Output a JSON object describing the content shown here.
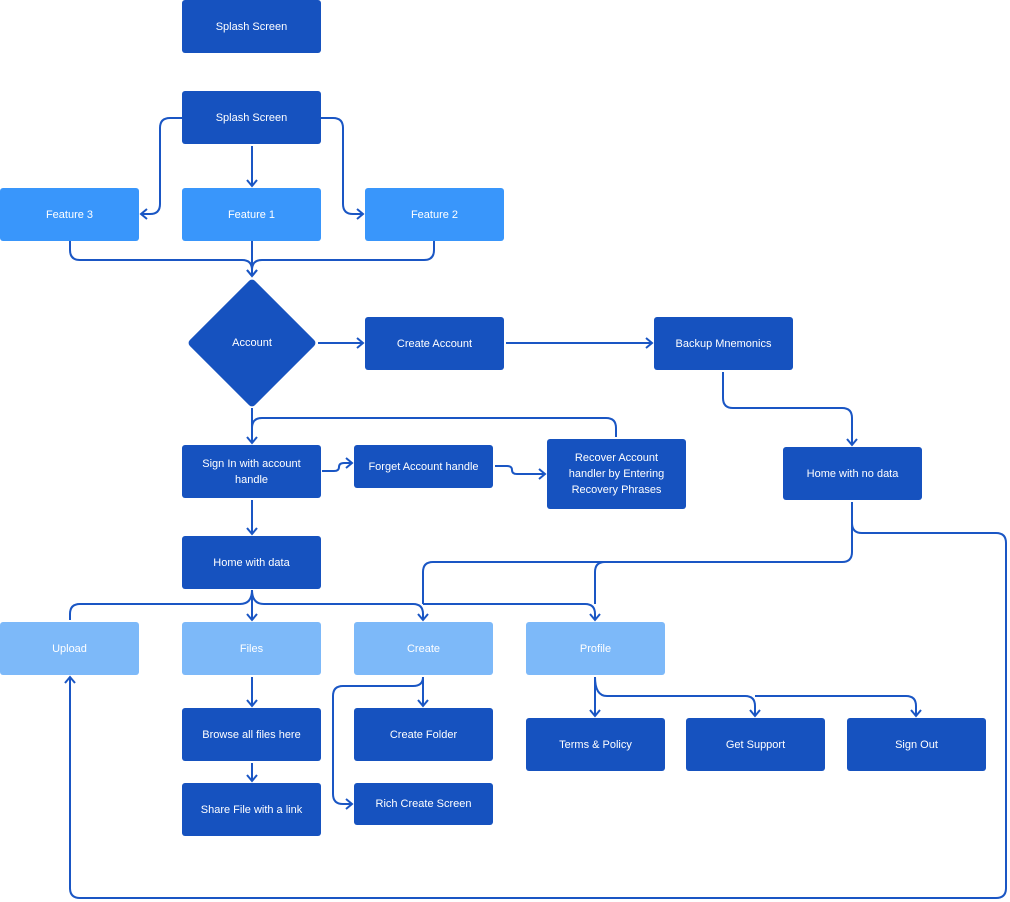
{
  "colors": {
    "primary": "#1652bf",
    "secondary": "#3996fb",
    "tertiary": "#7db9f9",
    "edge": "#1a56c4"
  },
  "nodes": {
    "splash_top": "Splash Screen",
    "splash": "Splash Screen",
    "feature3": "Feature 3",
    "feature1": "Feature 1",
    "feature2": "Feature 2",
    "account": "Account",
    "create_account": "Create Account",
    "backup_mnemonics": "Backup Mnemonics",
    "sign_in": "Sign In with account handle",
    "forget_handle": "Forget Account handle",
    "recover": "Recover Account handler by Entering Recovery Phrases",
    "home_no_data": "Home with no data",
    "home_with_data": "Home with data",
    "upload": "Upload",
    "files": "Files",
    "create": "Create",
    "profile": "Profile",
    "browse": "Browse all files here",
    "share": "Share File with a link",
    "create_folder": "Create Folder",
    "rich_create": "Rich Create Screen",
    "terms": "Terms & Policy",
    "support": "Get Support",
    "sign_out": "Sign Out"
  }
}
